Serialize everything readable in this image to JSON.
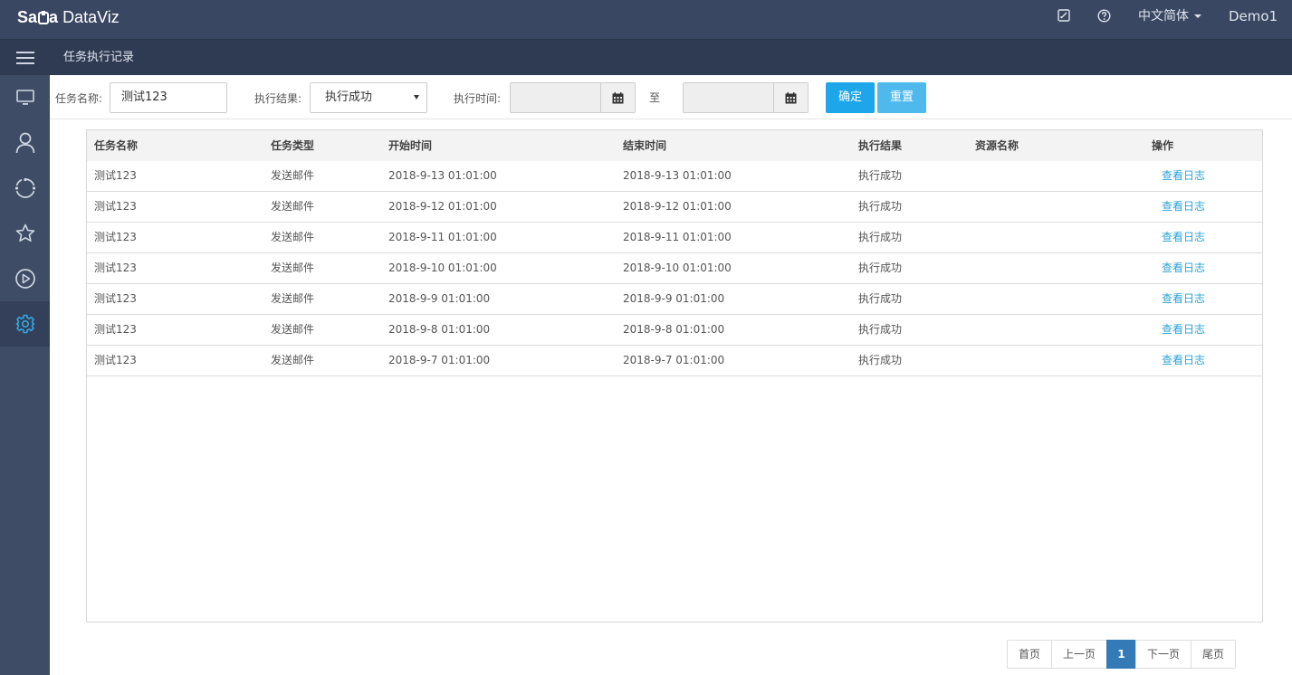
{
  "app": {
    "logo_prefix": "Sa",
    "logo_mid": "a",
    "logo_suffix": "DataViz"
  },
  "topbar": {
    "language": "中文简体",
    "user": "Demo1"
  },
  "subbar": {
    "page_title": "任务执行记录"
  },
  "sidebar": {
    "items": [
      {
        "icon": "monitor-icon"
      },
      {
        "icon": "user-icon"
      },
      {
        "icon": "refresh-circle-icon"
      },
      {
        "icon": "star-icon"
      },
      {
        "icon": "play-circle-icon"
      },
      {
        "icon": "gear-icon",
        "active": true
      }
    ]
  },
  "filters": {
    "task_name_label": "任务名称:",
    "task_name_value": "测试123",
    "result_label": "执行结果:",
    "result_value": "执行成功",
    "time_label": "执行时间:",
    "to_label": "至",
    "confirm_label": "确定",
    "reset_label": "重置"
  },
  "table": {
    "headers": [
      "任务名称",
      "任务类型",
      "开始时间",
      "结束时间",
      "执行结果",
      "资源名称",
      "操作"
    ],
    "rows": [
      [
        "测试123",
        "发送邮件",
        "2018-9-13 01:01:00",
        "2018-9-13 01:01:00",
        "执行成功",
        "",
        "查看日志"
      ],
      [
        "测试123",
        "发送邮件",
        "2018-9-12 01:01:00",
        "2018-9-12 01:01:00",
        "执行成功",
        "",
        "查看日志"
      ],
      [
        "测试123",
        "发送邮件",
        "2018-9-11 01:01:00",
        "2018-9-11 01:01:00",
        "执行成功",
        "",
        "查看日志"
      ],
      [
        "测试123",
        "发送邮件",
        "2018-9-10 01:01:00",
        "2018-9-10 01:01:00",
        "执行成功",
        "",
        "查看日志"
      ],
      [
        "测试123",
        "发送邮件",
        "2018-9-9 01:01:00",
        "2018-9-9 01:01:00",
        "执行成功",
        "",
        "查看日志"
      ],
      [
        "测试123",
        "发送邮件",
        "2018-9-8 01:01:00",
        "2018-9-8 01:01:00",
        "执行成功",
        "",
        "查看日志"
      ],
      [
        "测试123",
        "发送邮件",
        "2018-9-7 01:01:00",
        "2018-9-7 01:01:00",
        "执行成功",
        "",
        "查看日志"
      ]
    ]
  },
  "pagination": {
    "first": "首页",
    "prev": "上一页",
    "current": "1",
    "next": "下一页",
    "last": "尾页"
  },
  "colors": {
    "topbar": "#3a4762",
    "sidebar": "#3e4c66",
    "accent": "#1ea6ea",
    "link": "#29a3d9",
    "active_icon": "#35a8e0"
  }
}
